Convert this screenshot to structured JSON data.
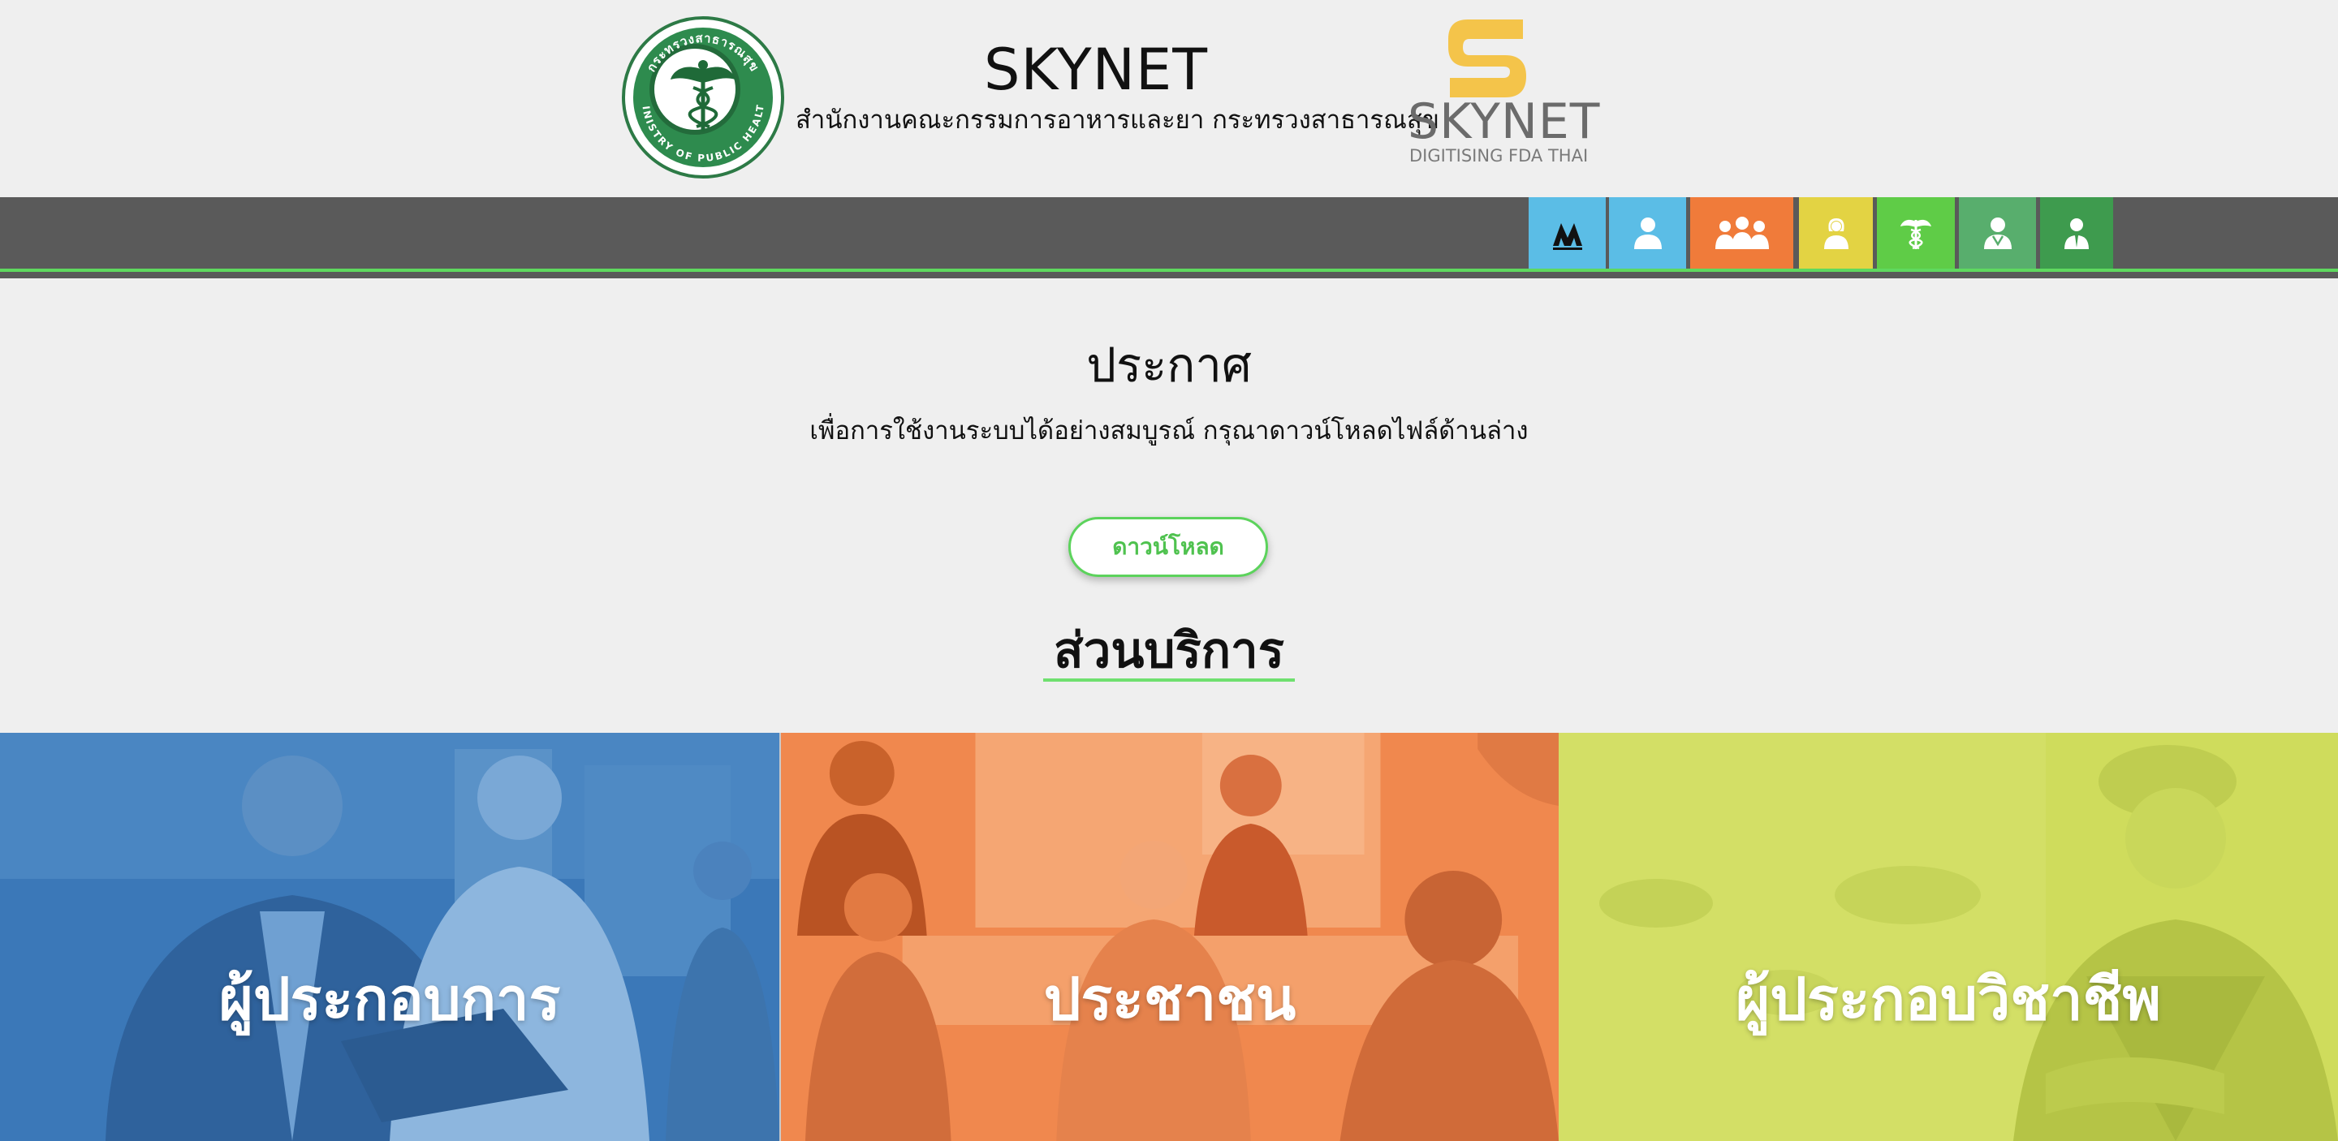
{
  "header": {
    "title": "SKYNET",
    "subtitle": "สำนักงานคณะกรรมการอาหารและยา กระทรวงสาธารณสุข",
    "seal": {
      "name": "ministry-of-public-health-seal",
      "text": "MINISTRY OF PUBLIC HEALTH",
      "thai_text": "กระทรวงสาธารณสุข"
    },
    "brand": {
      "name": "SKYNET",
      "tagline": "DIGITISING FDA THAI"
    }
  },
  "nav": {
    "tiles": [
      {
        "icon": "agency-logo-icon",
        "color": "#5bbde6"
      },
      {
        "icon": "person-icon",
        "color": "#5bbde6"
      },
      {
        "icon": "group-icon",
        "color": "#f07b3a"
      },
      {
        "icon": "woman-icon",
        "color": "#e3d343"
      },
      {
        "icon": "caduceus-icon",
        "color": "#5fcc47"
      },
      {
        "icon": "doctor-icon",
        "color": "#58ae6d"
      },
      {
        "icon": "officer-icon",
        "color": "#3e9b4e"
      }
    ],
    "bar_color": "#5a5a5a",
    "line_color": "#5fd95f"
  },
  "announcement": {
    "title": "ประกาศ",
    "text": "เพื่อการใช้งานระบบได้อย่างสมบูรณ์ กรุณาดาวน์โหลดไฟล์ด้านล่าง",
    "download_label": "ดาวน์โหลด"
  },
  "services": {
    "title": "ส่วนบริการ",
    "cards": [
      {
        "label": "ผู้ประกอบการ",
        "color": "#3b78b8"
      },
      {
        "label": "ประชาชน",
        "color": "#f0884e"
      },
      {
        "label": "ผู้ประกอบวิชาชีพ",
        "color": "#cfdc5c"
      }
    ]
  }
}
